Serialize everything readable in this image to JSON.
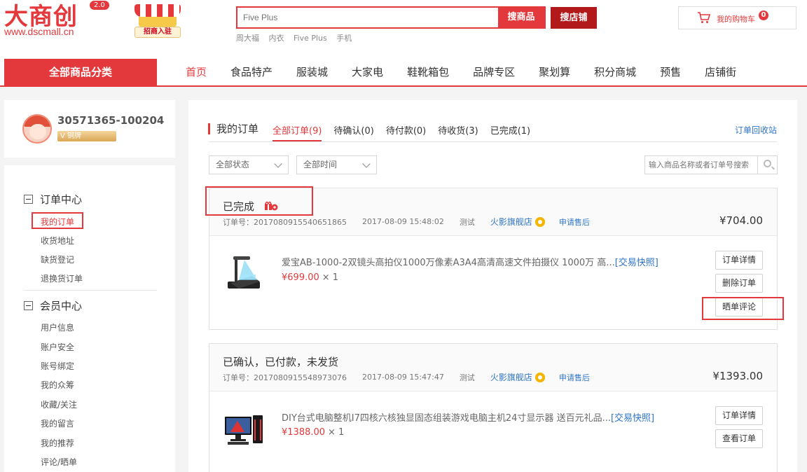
{
  "header": {
    "logo_text": "大商创",
    "logo_version": "2.0",
    "logo_url": "www.dscmall.cn",
    "promo_label": "招商入驻",
    "search_placeholder": "Five Plus",
    "search_button": "搜商品",
    "shop_button": "搜店铺",
    "hot_words": [
      "周大福",
      "内衣",
      "Five Plus",
      "手机"
    ],
    "cart_label": "我的购物车",
    "cart_count": "0"
  },
  "nav": {
    "category_label": "全部商品分类",
    "items": [
      "首页",
      "食品特产",
      "服装城",
      "大家电",
      "鞋靴箱包",
      "品牌专区",
      "聚划算",
      "积分商城",
      "预售",
      "店铺街"
    ]
  },
  "user": {
    "name": "30571365-100204",
    "rank": "V 铜牌"
  },
  "sidebar": {
    "order_center": "订单中心",
    "order_items": [
      "我的订单",
      "收货地址",
      "缺货登记",
      "退换货订单"
    ],
    "member_center": "会员中心",
    "member_items": [
      "用户信息",
      "账户安全",
      "账号绑定",
      "我的众筹",
      "收藏/关注",
      "我的留言",
      "我的推荐",
      "评论/晒单"
    ]
  },
  "main": {
    "title": "我的订单",
    "tabs": [
      "全部订单(9)",
      "待确认(0)",
      "待付款(0)",
      "待收货(3)",
      "已完成(1)"
    ],
    "recycle_link": "订单回收站",
    "filter_status": "全部状态",
    "filter_time": "全部时间",
    "search_placeholder": "输入商品名称或者订单号搜索"
  },
  "orders": [
    {
      "status": "已完成",
      "order_no": "订单号：2017080915540651865",
      "datetime": "2017-08-09 15:48:02",
      "tag": "测试",
      "shop": "火影旗舰店",
      "after_sale": "申请售后",
      "total": "¥704.00",
      "product_title": "爱宝AB-1000-2双镜头高拍仪1000万像素A3A4高清高速文件拍摄仪 1000万 高...",
      "snapshot": "[交易快照]",
      "price": "¥699.00",
      "qty": "× 1",
      "buttons": [
        "订单详情",
        "删除订单",
        "晒单评论"
      ]
    },
    {
      "status": "已确认，已付款，未发货",
      "order_no": "订单号：2017080915548973076",
      "datetime": "2017-08-09 15:47:47",
      "tag": "测试",
      "shop": "火影旗舰店",
      "after_sale": "申请售后",
      "total": "¥1393.00",
      "product_title": "DIY台式电脑整机I7四核六核独显固态组装游戏电脑主机24寸显示器 送百元礼品...",
      "snapshot": "[交易快照]",
      "price": "¥1388.00",
      "qty": "× 1",
      "buttons": [
        "订单详情",
        "查看订单"
      ]
    }
  ]
}
